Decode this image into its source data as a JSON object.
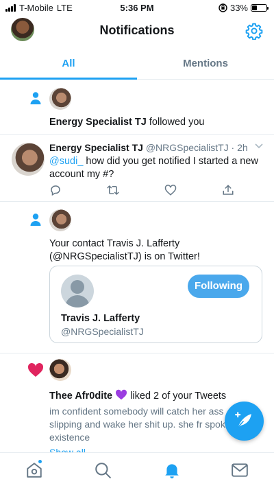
{
  "status_bar": {
    "carrier": "T-Mobile",
    "network": "LTE",
    "time": "5:36 PM",
    "battery": "33%",
    "battery_level": 0.33
  },
  "header": {
    "title": "Notifications"
  },
  "tabs": [
    {
      "label": "All",
      "active": true
    },
    {
      "label": "Mentions",
      "active": false
    }
  ],
  "notifications": {
    "follow": {
      "user": "Energy Specialist TJ",
      "action": "followed you"
    },
    "tweet": {
      "name": "Energy Specialist TJ",
      "handle": "@NRGSpecialistTJ",
      "time": "· 2h",
      "mention": "@sudi_",
      "text": " how did you get notified I started a new account my #?"
    },
    "contact": {
      "text": "Your contact Travis J. Lafferty (@NRGSpecialistTJ) is on Twitter!",
      "card": {
        "name": "Travis J. Lafferty",
        "handle": "@NRGSpecialistTJ",
        "button": "Following"
      }
    },
    "likes": {
      "user": "Thee Afr0dite",
      "action": "liked 2 of your Tweets",
      "snippet": "im confident somebody will catch her ass slipping and wake her shit up. she fr spoke into existence",
      "show_all": "Show all"
    }
  },
  "colors": {
    "accent": "#1da1f2",
    "like": "#e0245e",
    "purple_heart": "#9b3de0"
  }
}
